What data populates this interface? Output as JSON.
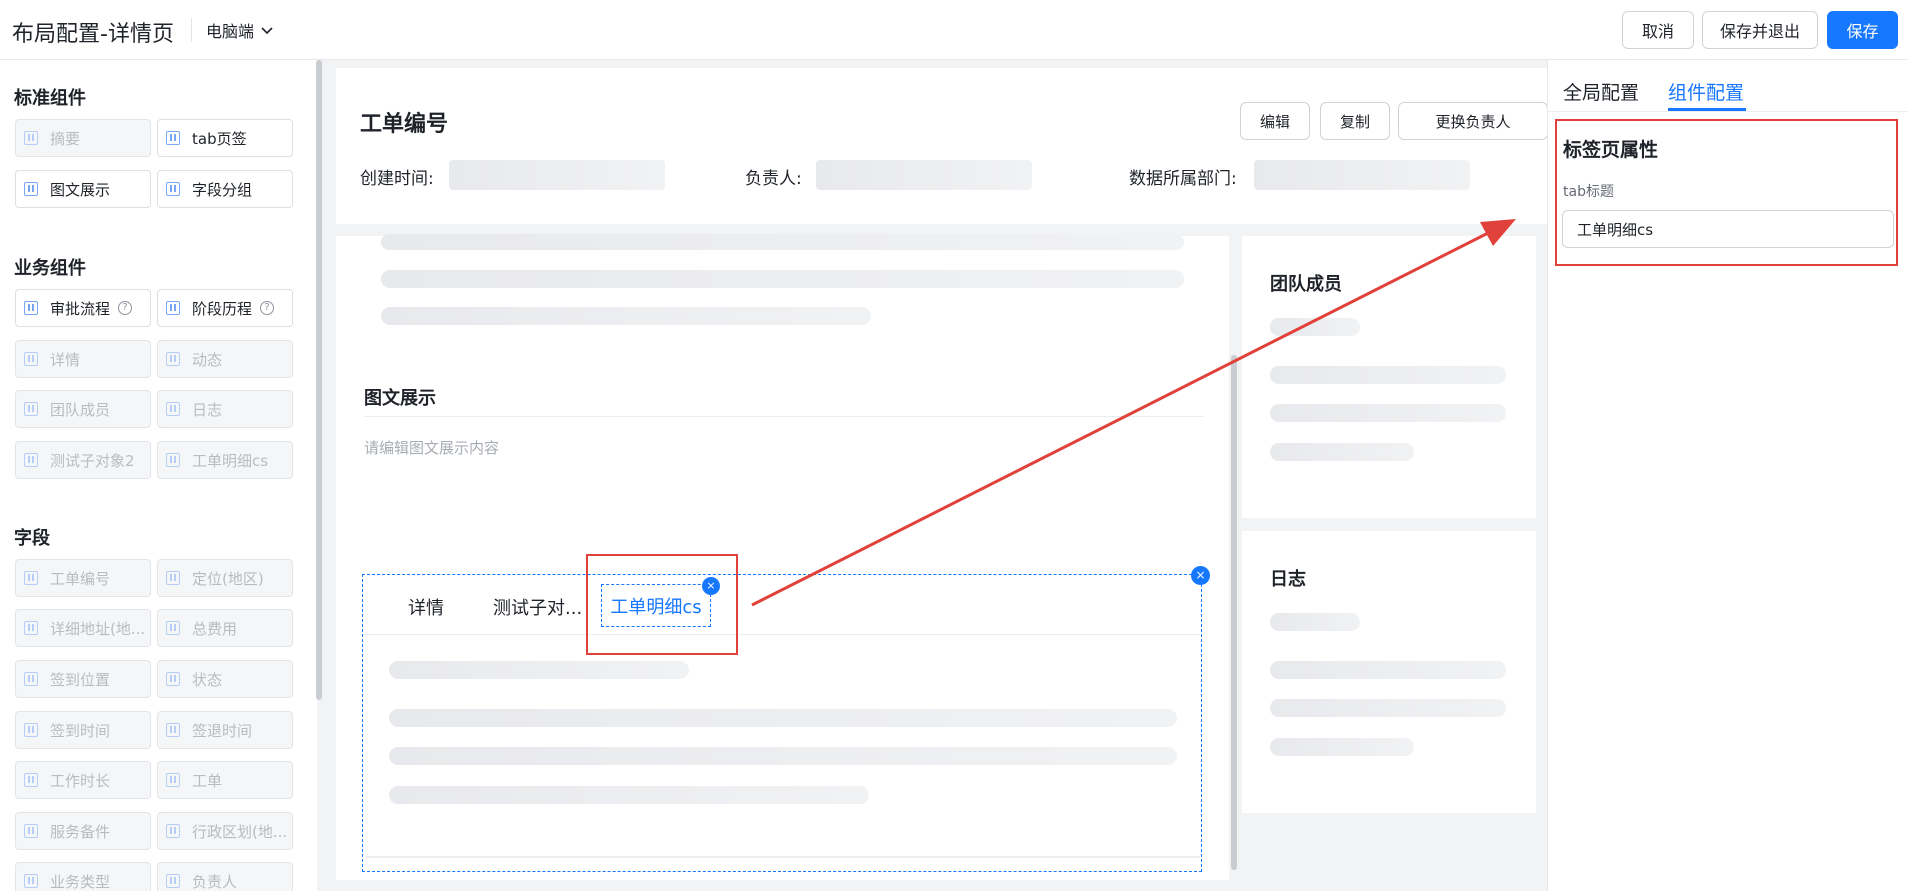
{
  "topbar": {
    "title": "布局配置-详情页",
    "device": "电脑端",
    "cancel": "取消",
    "save_exit": "保存并退出",
    "save": "保存"
  },
  "sidebar": {
    "standard_title": "标准组件",
    "standard": [
      {
        "label": "摘要",
        "disabled": true
      },
      {
        "label": "tab页签",
        "disabled": false
      },
      {
        "label": "图文展示",
        "disabled": false
      },
      {
        "label": "字段分组",
        "disabled": false
      }
    ],
    "business_title": "业务组件",
    "business": [
      {
        "label": "审批流程",
        "disabled": false,
        "help": true
      },
      {
        "label": "阶段历程",
        "disabled": false,
        "help": true
      },
      {
        "label": "详情",
        "disabled": true
      },
      {
        "label": "动态",
        "disabled": true
      },
      {
        "label": "团队成员",
        "disabled": true
      },
      {
        "label": "日志",
        "disabled": true
      },
      {
        "label": "测试子对象2",
        "disabled": true
      },
      {
        "label": "工单明细cs",
        "disabled": true
      }
    ],
    "fields_title": "字段",
    "fields": [
      {
        "label": "工单编号",
        "disabled": true
      },
      {
        "label": "定位(地区)",
        "disabled": true
      },
      {
        "label": "详细地址(地...",
        "disabled": true
      },
      {
        "label": "总费用",
        "disabled": true
      },
      {
        "label": "签到位置",
        "disabled": true
      },
      {
        "label": "状态",
        "disabled": true
      },
      {
        "label": "签到时间",
        "disabled": true
      },
      {
        "label": "签退时间",
        "disabled": true
      },
      {
        "label": "工作时长",
        "disabled": true
      },
      {
        "label": "工单",
        "disabled": true
      },
      {
        "label": "服务备件",
        "disabled": true
      },
      {
        "label": "行政区划(地...",
        "disabled": true
      },
      {
        "label": "业务类型",
        "disabled": true
      },
      {
        "label": "负责人",
        "disabled": true
      }
    ],
    "help_glyph": "?"
  },
  "canvas": {
    "header_title": "工单编号",
    "btn_edit": "编辑",
    "btn_copy": "复制",
    "btn_change_owner": "更换负责人",
    "field_created": "创建时间:",
    "field_owner": "负责人:",
    "field_dept": "数据所属部门:",
    "image_section_title": "图文展示",
    "image_placeholder": "请编辑图文展示内容",
    "tabs": [
      "详情",
      "测试子对..."
    ],
    "active_tab": "工单明细cs",
    "close_glyph": "×",
    "team_title": "团队成员",
    "log_title": "日志"
  },
  "right_panel": {
    "tab_global": "全局配置",
    "tab_component": "组件配置",
    "prop_title": "标签页属性",
    "field_label": "tab标题",
    "field_value": "工单明细cs"
  },
  "colors": {
    "primary": "#1677ff",
    "annotation": "#e0413a"
  },
  "icons": {
    "device_dropdown": "chevron-down-icon",
    "component_chip": "component-drag-icon",
    "help": "help-circle-icon",
    "close": "close-icon"
  }
}
